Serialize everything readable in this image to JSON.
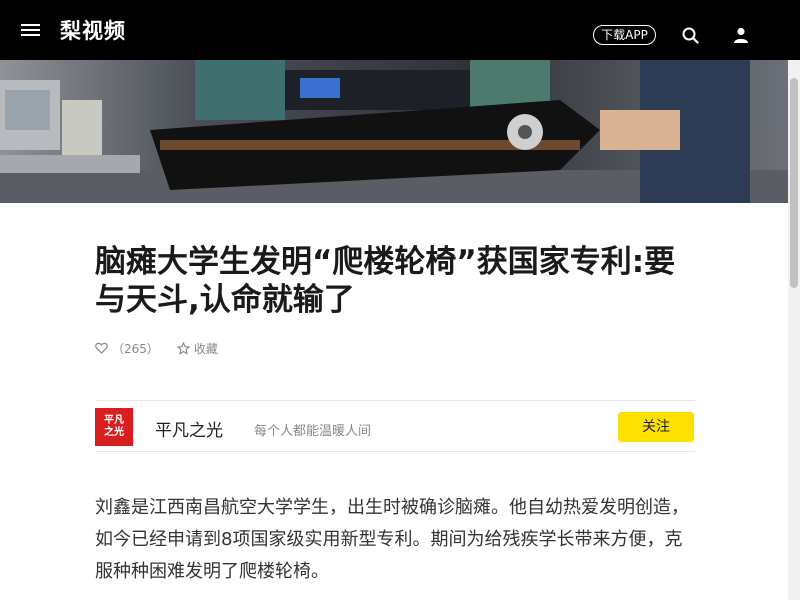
{
  "header": {
    "logo": "梨视频",
    "download_label": "下载APP"
  },
  "article": {
    "title": "脑瘫大学生发明“爬楼轮椅”获国家专利:要与天斗,认命就输了",
    "likes": "（265）",
    "favorite_label": "收藏",
    "body": "刘鑫是江西南昌航空大学学生，出生时被确诊脑瘫。他自幼热爱发明创造，如今已经申请到8项国家级实用新型专利。期间为给残疾学长带来方便，克服种种困难发明了爬楼轮椅。"
  },
  "author": {
    "avatar_text_line1": "平凡",
    "avatar_text_line2": "之光",
    "name": "平凡之光",
    "description": "每个人都能温暖人间",
    "follow_label": "关注"
  },
  "colors": {
    "topbar": "#000000",
    "follow_button": "#ffe100",
    "avatar": "#d81e1e"
  }
}
